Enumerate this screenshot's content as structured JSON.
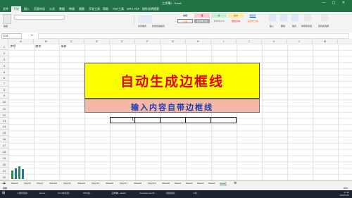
{
  "window": {
    "title": "工作簿1 - Excel",
    "controls": "— ▢ ✕"
  },
  "ribbon_tabs": [
    "文件",
    "开始",
    "插入",
    "页面布局",
    "公式",
    "数据",
    "审阅",
    "视图",
    "开发工具",
    "帮助",
    "PDF工具",
    "WPS PDF",
    "操作说明搜索"
  ],
  "ribbon": {
    "styles": [
      {
        "label": "常规",
        "bg": "#ffffff",
        "fg": "#000000"
      },
      {
        "label": "差",
        "bg": "#ffc7ce",
        "fg": "#9c0006"
      },
      {
        "label": "好",
        "bg": "#c6efce",
        "fg": "#006100"
      },
      {
        "label": "适中",
        "bg": "#ffeb9c",
        "fg": "#9c5700"
      },
      {
        "label": "超链接",
        "bg": "#ffffff",
        "fg": "#0563c1"
      },
      {
        "label": "计算",
        "bg": "#f2f2f2",
        "fg": "#fa7d00"
      },
      {
        "label": "检查单元格",
        "bg": "#a5a5a5",
        "fg": "#ffffff"
      },
      {
        "label": "解释性文本",
        "bg": "#ffffff",
        "fg": "#7f7f7f"
      },
      {
        "label": "警告文本",
        "bg": "#ffffff",
        "fg": "#ff0000"
      },
      {
        "label": "链接单元格",
        "bg": "#ffffff",
        "fg": "#fa7d00"
      }
    ],
    "buttons": [
      "粘贴",
      "条件格式",
      "套用表格格式",
      "插入",
      "删除",
      "格式",
      "排序和筛选",
      "查找和选择"
    ]
  },
  "formula_bar": {
    "name_box": "C14",
    "fx": "fx"
  },
  "columns": [
    "A",
    "B",
    "C",
    "D",
    "E",
    "F",
    "G",
    "H",
    "I",
    "J",
    "K",
    "L",
    "M"
  ],
  "rows": [
    "1",
    "2",
    "3",
    "4",
    "5",
    "6",
    "7",
    "8",
    "9",
    "10",
    "11",
    "12",
    "13",
    "14",
    "15",
    "16",
    "17",
    "18",
    "19",
    "20",
    "21",
    "22"
  ],
  "cells": {
    "a1": "序号",
    "b1": "姓名",
    "c1": "年龄",
    "e13": "1"
  },
  "banner": {
    "title": "自动生成边框线",
    "subtitle": "输入内容自带边框线"
  },
  "sheet_tabs": [
    "Sheet9",
    "Sheet8",
    "Sheet7",
    "Sheet12",
    "Sheet11",
    "Sheet13",
    "Sheet14",
    "Sheet16",
    "Sheet17",
    "Sheet15",
    "Sheet19",
    "Sheet20",
    "Sheet1",
    "Sheet2",
    "Sheet3",
    "Sheet4",
    "Sheet5"
  ],
  "active_sheet": "Sheet5",
  "status": {
    "left": "就绪",
    "zoom": "90%"
  },
  "taskbar": {
    "items": [
      "八角智慧的...",
      "[Excel...",
      "Word中实现...",
      "WPS会...",
      "工作簿1 - Excel",
      "Camtasia Studio ...",
      "视频剪辑...",
      "A 新..."
    ],
    "time": "14:30",
    "date": "2020/5/26"
  },
  "colors": {
    "excel_green": "#217346",
    "yellow": "#ffff00",
    "pink": "#f4b6a6",
    "title_red": "#e60000",
    "subtitle_blue": "#1a3fb0"
  }
}
